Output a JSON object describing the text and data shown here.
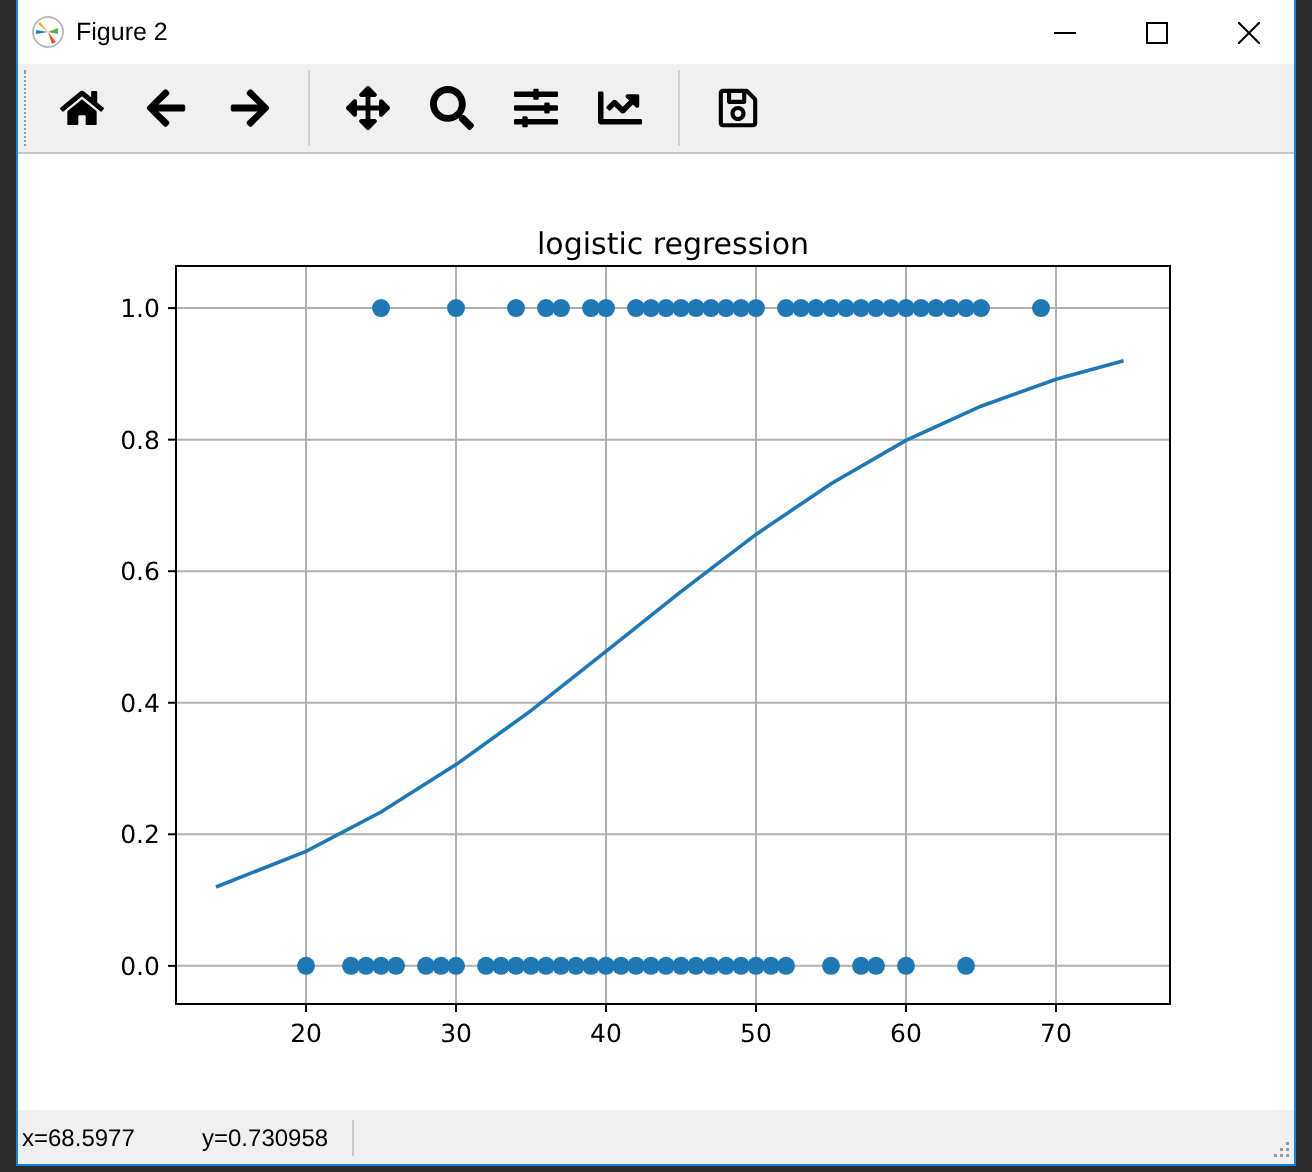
{
  "window": {
    "title": "Figure 2"
  },
  "figure": {
    "chart_data": {
      "type": "scatter",
      "title": "logistic regression",
      "grid": true,
      "xlim": [
        11.33,
        77.6
      ],
      "ylim": [
        -0.058,
        1.064
      ],
      "xticks": [
        20,
        30,
        40,
        50,
        60,
        70
      ],
      "yticks": [
        {
          "value": 0,
          "label": "0.0"
        },
        {
          "value": 0.2,
          "label": "0.2"
        },
        {
          "value": 0.4,
          "label": "0.4"
        },
        {
          "value": 0.6,
          "label": "0.6"
        },
        {
          "value": 0.8,
          "label": "0.8"
        },
        {
          "value": 1,
          "label": "1.0"
        }
      ],
      "series": [
        {
          "color": "#1f77b4",
          "x": [
            25,
            30,
            34,
            36,
            37,
            39,
            40,
            42,
            43,
            44,
            45,
            46,
            47,
            48,
            49,
            50,
            52,
            53,
            54,
            55,
            56,
            57,
            58,
            59,
            60,
            61,
            62,
            63,
            64,
            65,
            69
          ],
          "values": [
            1,
            1,
            1,
            1,
            1,
            1,
            1,
            1,
            1,
            1,
            1,
            1,
            1,
            1,
            1,
            1,
            1,
            1,
            1,
            1,
            1,
            1,
            1,
            1,
            1,
            1,
            1,
            1,
            1,
            1,
            1
          ]
        },
        {
          "color": "#1f77b4",
          "x": [
            20,
            23,
            24,
            25,
            26,
            28,
            29,
            30,
            32,
            33,
            34,
            35,
            36,
            37,
            38,
            39,
            40,
            41,
            42,
            43,
            44,
            45,
            46,
            47,
            48,
            49,
            50,
            51,
            52,
            55,
            57,
            58,
            60,
            64
          ],
          "values": [
            0,
            0,
            0,
            0,
            0,
            0,
            0,
            0,
            0,
            0,
            0,
            0,
            0,
            0,
            0,
            0,
            0,
            0,
            0,
            0,
            0,
            0,
            0,
            0,
            0,
            0,
            0,
            0,
            0,
            0,
            0,
            0,
            0,
            0
          ]
        },
        {
          "type": "line",
          "color": "#1f77b4",
          "x": [
            14,
            20,
            25,
            30,
            35,
            40,
            45,
            50,
            55,
            60,
            65,
            70,
            74.5
          ],
          "values": [
            0.12,
            0.174,
            0.234,
            0.306,
            0.388,
            0.478,
            0.569,
            0.656,
            0.733,
            0.799,
            0.851,
            0.892,
            0.92
          ]
        }
      ]
    }
  },
  "status_bar": {
    "x_reading": "x=68.5977",
    "y_reading": "y=0.730958"
  }
}
